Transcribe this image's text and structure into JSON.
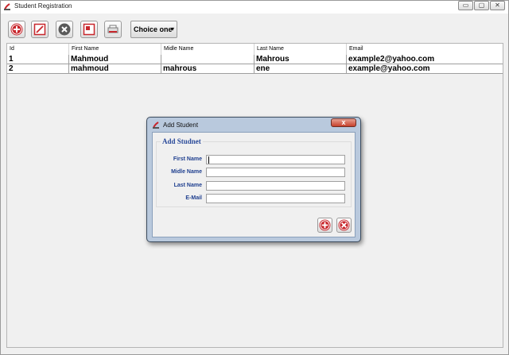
{
  "window": {
    "title": "Student Registration",
    "controls": {
      "minimize": "▭",
      "maximize": "▢",
      "close": "✕"
    }
  },
  "toolbar": {
    "buttons": [
      {
        "icon": "add-icon"
      },
      {
        "icon": "edit-icon"
      },
      {
        "icon": "delete-icon"
      },
      {
        "icon": "view-icon"
      },
      {
        "icon": "print-icon"
      }
    ],
    "combo_value": "Choice one",
    "combo_arrow": "▾"
  },
  "table": {
    "columns": [
      "Id",
      "First Name",
      "Midle Name",
      "Last Name",
      "Email"
    ],
    "rows": [
      {
        "id": "1",
        "first": "Mahmoud",
        "middle": "",
        "last": "Mahrous",
        "email": "example2@yahoo.com"
      },
      {
        "id": "2",
        "first": "mahmoud",
        "middle": "mahrous",
        "last": "ene",
        "email": "example@yahoo.com"
      }
    ]
  },
  "dialog": {
    "title": "Add Student",
    "close_label": "x",
    "group_title": "Add Studnet",
    "fields": [
      {
        "label": "First Name",
        "value": ""
      },
      {
        "label": "Midle Name",
        "value": ""
      },
      {
        "label": "Last Name",
        "value": ""
      },
      {
        "label": "E-Mail",
        "value": ""
      }
    ]
  },
  "colors": {
    "accent_red": "#c8262c",
    "label_blue": "#1f3f8f",
    "dialog_frame": "#b9c9dd"
  }
}
